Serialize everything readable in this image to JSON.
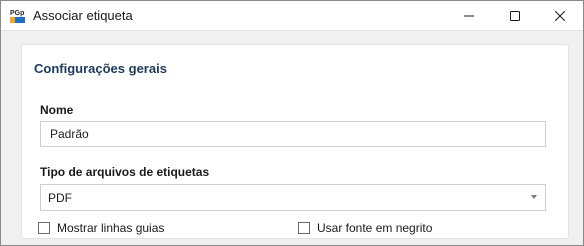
{
  "window": {
    "title": "Associar etiqueta",
    "app_icon_text": "PGp",
    "buttons": [
      "minimize",
      "maximize",
      "close"
    ]
  },
  "panel": {
    "section_title": "Configurações gerais",
    "nome": {
      "label": "Nome",
      "value": "Padrão"
    },
    "tipo": {
      "label": "Tipo de arquivos de etiquetas",
      "selected": "PDF"
    },
    "checkboxes": [
      {
        "label": "Mostrar linhas guias",
        "checked": false
      },
      {
        "label": "Usar fonte em negrito",
        "checked": false
      }
    ]
  },
  "colors": {
    "section_title": "#1e3a5f",
    "window_bg": "#f0f0f0",
    "panel_bg": "#ffffff",
    "border": "#cfcfcf"
  },
  "icons": {
    "app": "app-logo-icon",
    "minimize": "minimize-icon",
    "maximize": "maximize-icon",
    "close": "close-icon",
    "dropdown": "chevron-down-icon"
  }
}
